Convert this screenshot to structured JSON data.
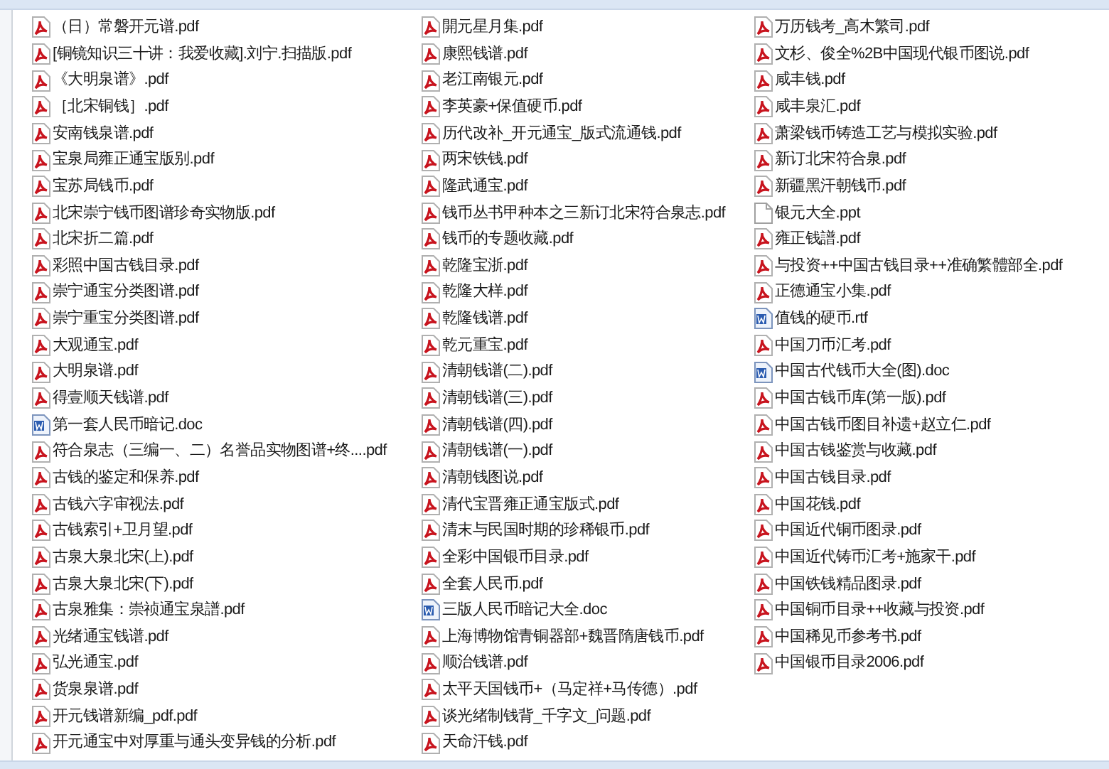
{
  "columns": [
    [
      {
        "name": "（日）常磐开元谱.pdf",
        "kind": "pdf"
      },
      {
        "name": "[铜镜知识三十讲：我爱收藏].刘宁.扫描版.pdf",
        "kind": "pdf"
      },
      {
        "name": "《大明泉谱》.pdf",
        "kind": "pdf"
      },
      {
        "name": "［北宋铜钱］.pdf",
        "kind": "pdf"
      },
      {
        "name": "安南钱泉谱.pdf",
        "kind": "pdf"
      },
      {
        "name": "宝泉局雍正通宝版别.pdf",
        "kind": "pdf"
      },
      {
        "name": "宝苏局钱币.pdf",
        "kind": "pdf"
      },
      {
        "name": "北宋崇宁钱币图谱珍奇实物版.pdf",
        "kind": "pdf"
      },
      {
        "name": "北宋折二篇.pdf",
        "kind": "pdf"
      },
      {
        "name": "彩照中国古钱目录.pdf",
        "kind": "pdf"
      },
      {
        "name": "崇宁通宝分类图谱.pdf",
        "kind": "pdf"
      },
      {
        "name": "崇宁重宝分类图谱.pdf",
        "kind": "pdf"
      },
      {
        "name": "大观通宝.pdf",
        "kind": "pdf"
      },
      {
        "name": "大明泉谱.pdf",
        "kind": "pdf"
      },
      {
        "name": "得壹顺天钱谱.pdf",
        "kind": "pdf"
      },
      {
        "name": "第一套人民币暗记.doc",
        "kind": "word"
      },
      {
        "name": "符合泉志（三编一、二）名誉品实物图谱+终....pdf",
        "kind": "pdf"
      },
      {
        "name": "古钱的鉴定和保养.pdf",
        "kind": "pdf"
      },
      {
        "name": "古钱六字审视法.pdf",
        "kind": "pdf"
      },
      {
        "name": "古钱索引+卫月望.pdf",
        "kind": "pdf"
      },
      {
        "name": "古泉大泉北宋(上).pdf",
        "kind": "pdf"
      },
      {
        "name": "古泉大泉北宋(下).pdf",
        "kind": "pdf"
      },
      {
        "name": "古泉雅集：崇祯通宝泉譜.pdf",
        "kind": "pdf"
      },
      {
        "name": "光绪通宝钱谱.pdf",
        "kind": "pdf"
      },
      {
        "name": "弘光通宝.pdf",
        "kind": "pdf"
      },
      {
        "name": "货泉泉谱.pdf",
        "kind": "pdf"
      },
      {
        "name": "开元钱谱新编_pdf.pdf",
        "kind": "pdf"
      },
      {
        "name": "开元通宝中对厚重与通头变异钱的分析.pdf",
        "kind": "pdf"
      }
    ],
    [
      {
        "name": "開元星月集.pdf",
        "kind": "pdf"
      },
      {
        "name": "康熙钱谱.pdf",
        "kind": "pdf"
      },
      {
        "name": "老江南银元.pdf",
        "kind": "pdf"
      },
      {
        "name": "李英豪+保值硬币.pdf",
        "kind": "pdf"
      },
      {
        "name": "历代改补_开元通宝_版式流通钱.pdf",
        "kind": "pdf"
      },
      {
        "name": "两宋铁钱.pdf",
        "kind": "pdf"
      },
      {
        "name": "隆武通宝.pdf",
        "kind": "pdf"
      },
      {
        "name": "钱币丛书甲种本之三新订北宋符合泉志.pdf",
        "kind": "pdf"
      },
      {
        "name": "钱币的专题收藏.pdf",
        "kind": "pdf"
      },
      {
        "name": "乾隆宝浙.pdf",
        "kind": "pdf"
      },
      {
        "name": "乾隆大样.pdf",
        "kind": "pdf"
      },
      {
        "name": "乾隆钱谱.pdf",
        "kind": "pdf"
      },
      {
        "name": "乾元重宝.pdf",
        "kind": "pdf"
      },
      {
        "name": "清朝钱谱(二).pdf",
        "kind": "pdf"
      },
      {
        "name": "清朝钱谱(三).pdf",
        "kind": "pdf"
      },
      {
        "name": "清朝钱谱(四).pdf",
        "kind": "pdf"
      },
      {
        "name": "清朝钱谱(一).pdf",
        "kind": "pdf"
      },
      {
        "name": "清朝钱图说.pdf",
        "kind": "pdf"
      },
      {
        "name": "清代宝晋雍正通宝版式.pdf",
        "kind": "pdf"
      },
      {
        "name": "清末与民国时期的珍稀银币.pdf",
        "kind": "pdf"
      },
      {
        "name": "全彩中国银币目录.pdf",
        "kind": "pdf"
      },
      {
        "name": "全套人民币.pdf",
        "kind": "pdf"
      },
      {
        "name": "三版人民币暗记大全.doc",
        "kind": "word"
      },
      {
        "name": "上海博物馆青铜器部+魏晋隋唐钱币.pdf",
        "kind": "pdf"
      },
      {
        "name": "顺治钱谱.pdf",
        "kind": "pdf"
      },
      {
        "name": "太平天国钱币+（马定祥+马传德）.pdf",
        "kind": "pdf"
      },
      {
        "name": "谈光绪制钱背_千字文_问题.pdf",
        "kind": "pdf"
      },
      {
        "name": "天命汗钱.pdf",
        "kind": "pdf"
      }
    ],
    [
      {
        "name": "万历钱考_高木繁司.pdf",
        "kind": "pdf"
      },
      {
        "name": "文杉、俊全%2B中国现代银币图说.pdf",
        "kind": "pdf"
      },
      {
        "name": "咸丰钱.pdf",
        "kind": "pdf"
      },
      {
        "name": "咸丰泉汇.pdf",
        "kind": "pdf"
      },
      {
        "name": "萧梁钱币铸造工艺与模拟实验.pdf",
        "kind": "pdf"
      },
      {
        "name": "新订北宋符合泉.pdf",
        "kind": "pdf"
      },
      {
        "name": "新疆黑汗朝钱币.pdf",
        "kind": "pdf"
      },
      {
        "name": "银元大全.ppt",
        "kind": "blank"
      },
      {
        "name": "雍正钱譜.pdf",
        "kind": "pdf"
      },
      {
        "name": "与投资++中国古钱目录++准确繁體部全.pdf",
        "kind": "pdf"
      },
      {
        "name": "正德通宝小集.pdf",
        "kind": "pdf"
      },
      {
        "name": "值钱的硬币.rtf",
        "kind": "word"
      },
      {
        "name": "中国刀币汇考.pdf",
        "kind": "pdf"
      },
      {
        "name": "中国古代钱币大全(图).doc",
        "kind": "word"
      },
      {
        "name": "中国古钱币库(第一版).pdf",
        "kind": "pdf"
      },
      {
        "name": "中国古钱币图目补遗+赵立仁.pdf",
        "kind": "pdf"
      },
      {
        "name": "中国古钱鉴赏与收藏.pdf",
        "kind": "pdf"
      },
      {
        "name": "中国古钱目录.pdf",
        "kind": "pdf"
      },
      {
        "name": "中国花钱.pdf",
        "kind": "pdf"
      },
      {
        "name": "中国近代铜币图录.pdf",
        "kind": "pdf"
      },
      {
        "name": "中国近代铸币汇考+施家干.pdf",
        "kind": "pdf"
      },
      {
        "name": "中国铁钱精品图录.pdf",
        "kind": "pdf"
      },
      {
        "name": "中国铜币目录++收藏与投资.pdf",
        "kind": "pdf"
      },
      {
        "name": "中国稀见币参考书.pdf",
        "kind": "pdf"
      },
      {
        "name": "中国银币目录2006.pdf",
        "kind": "pdf"
      }
    ]
  ]
}
